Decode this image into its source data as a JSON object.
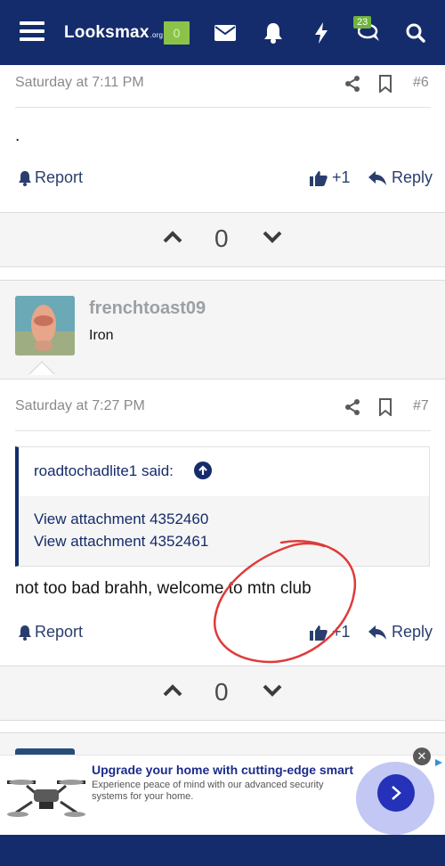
{
  "navbar": {
    "logo_text": "Looksmax",
    "logo_suffix": ".org",
    "alerts_count": "0",
    "conversations_count": "23"
  },
  "post6": {
    "date": "Saturday at 7:11 PM",
    "number": "#6",
    "body": ".",
    "report_label": "Report",
    "like_label": "+1",
    "reply_label": "Reply",
    "vote_count": "0"
  },
  "post7": {
    "username": "frenchtoast09",
    "user_title": "Iron",
    "date": "Saturday at 7:27 PM",
    "number": "#7",
    "quote": {
      "author": "roadtochadlite1 said:",
      "attachments": [
        "View attachment 4352460",
        "View attachment 4352461"
      ]
    },
    "body": "not too bad brahh, welcome to mtn club",
    "report_label": "Report",
    "like_label": "+1",
    "reply_label": "Reply",
    "vote_count": "0"
  },
  "ad": {
    "title": "Upgrade your home with cutting-edge smart",
    "description": "Experience peace of mind with our advanced security systems for your home.",
    "close_label": "✕"
  },
  "colors": {
    "navbar": "#142c6b",
    "accent": "#2a3e6e",
    "annotation_red": "#e03a3a"
  }
}
